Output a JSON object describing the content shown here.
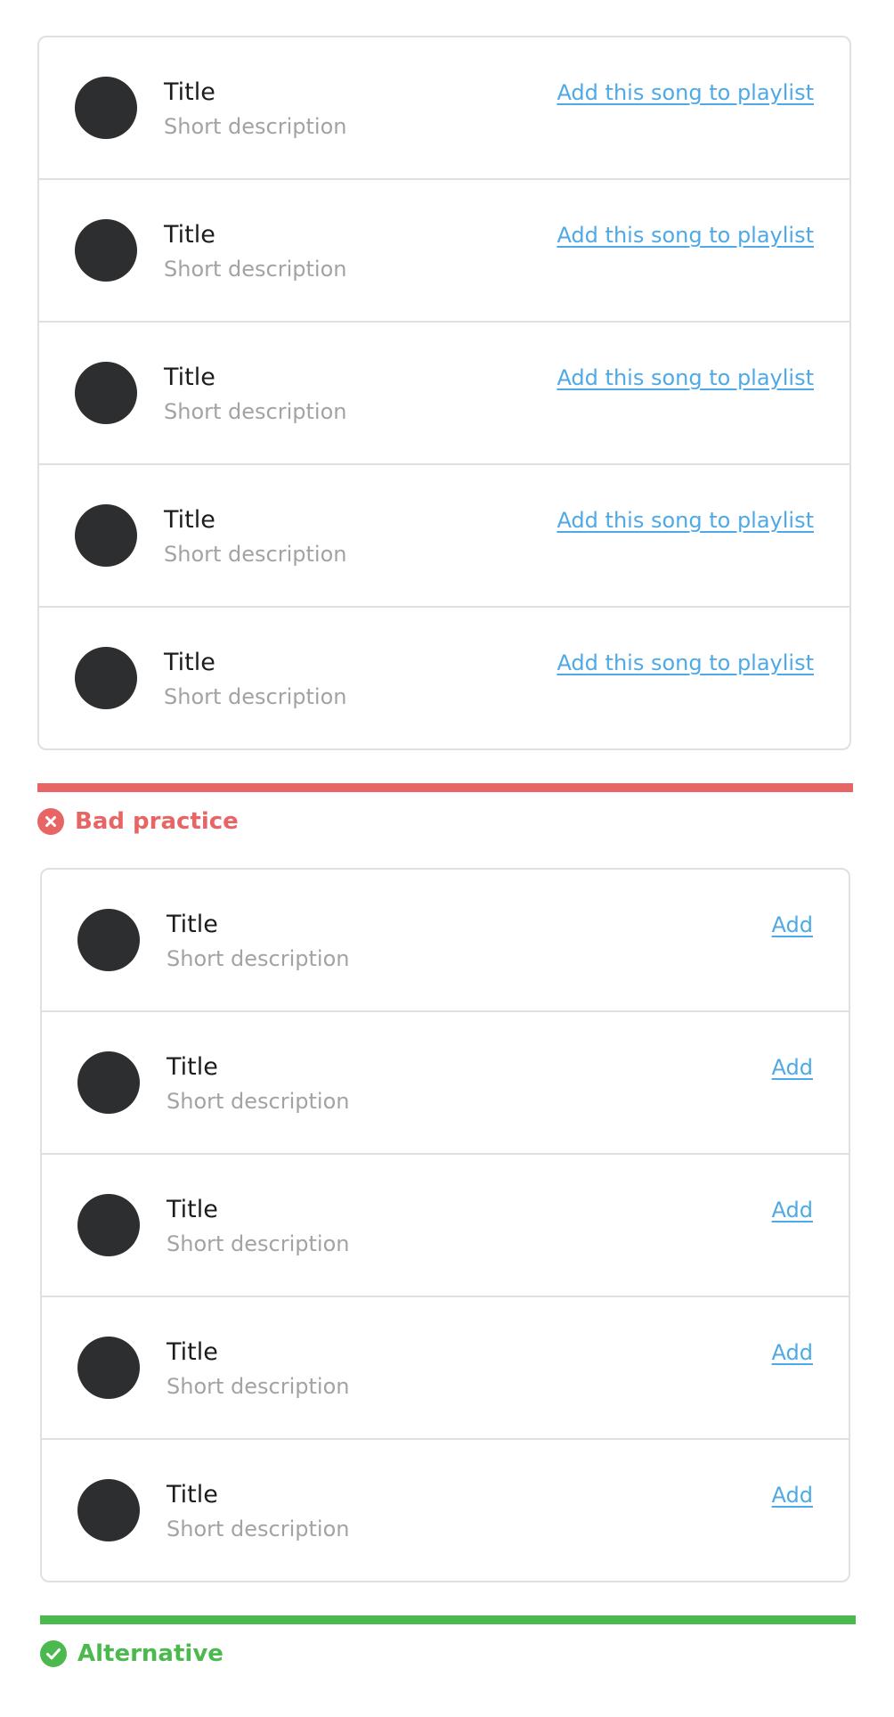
{
  "colors": {
    "bad": "#e86565",
    "good": "#4cb94e",
    "link": "#4fa9e6",
    "avatar": "#2d2e30"
  },
  "bad_example": {
    "items": [
      {
        "title": "Title",
        "description": "Short description",
        "action": "Add this song to playlist"
      },
      {
        "title": "Title",
        "description": "Short description",
        "action": "Add this song to playlist"
      },
      {
        "title": "Title",
        "description": "Short description",
        "action": "Add this song to playlist"
      },
      {
        "title": "Title",
        "description": "Short description",
        "action": "Add this song to playlist"
      },
      {
        "title": "Title",
        "description": "Short description",
        "action": "Add this song to playlist"
      }
    ],
    "verdict_icon": "x-circle-icon",
    "verdict_label": "Bad practice"
  },
  "good_example": {
    "items": [
      {
        "title": "Title",
        "description": "Short description",
        "action": "Add"
      },
      {
        "title": "Title",
        "description": "Short description",
        "action": "Add"
      },
      {
        "title": "Title",
        "description": "Short description",
        "action": "Add"
      },
      {
        "title": "Title",
        "description": "Short description",
        "action": "Add"
      },
      {
        "title": "Title",
        "description": "Short description",
        "action": "Add"
      }
    ],
    "verdict_icon": "check-circle-icon",
    "verdict_label": "Alternative"
  }
}
